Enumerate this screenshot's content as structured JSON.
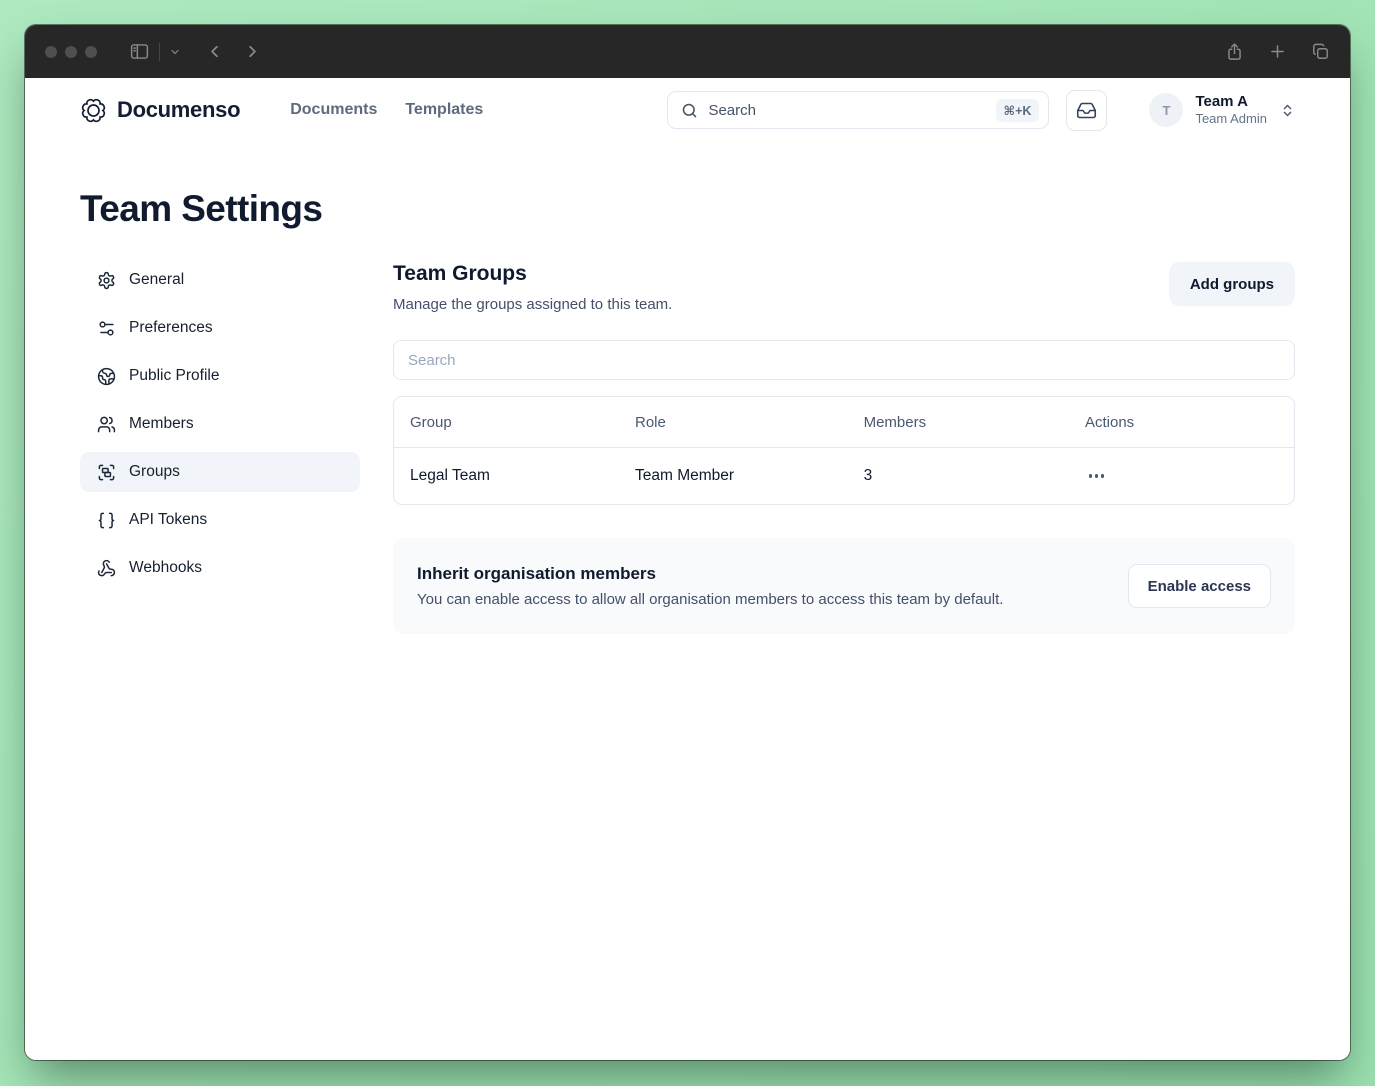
{
  "colors": {
    "desktop_green": "#a2e4b5",
    "titlebar": "#272727",
    "brand_navy": "#131e33",
    "muted_text": "#64748b",
    "active_item_bg": "#f1f5f9",
    "border": "#e2e8f0",
    "card_bg": "#f8fafc"
  },
  "titlebar": {
    "icons": [
      "sidebar-toggle-icon",
      "chevron-down-icon",
      "back-icon",
      "forward-icon",
      "share-icon",
      "new-tab-icon",
      "tab-overview-icon"
    ]
  },
  "header": {
    "brand": "Documenso",
    "logo_icon": "documenso-seal-icon",
    "nav": [
      {
        "label": "Documents"
      },
      {
        "label": "Templates"
      }
    ],
    "search": {
      "placeholder": "Search",
      "shortcut": "⌘+K",
      "icon": "search-icon"
    },
    "inbox_icon": "inbox-icon",
    "team": {
      "avatar_letter": "T",
      "name": "Team A",
      "role": "Team Admin",
      "switch_icon": "chevrons-up-down-icon"
    }
  },
  "page": {
    "title": "Team Settings"
  },
  "sidebar": {
    "items": [
      {
        "label": "General",
        "icon": "gear-icon",
        "active": false
      },
      {
        "label": "Preferences",
        "icon": "sliders-icon",
        "active": false
      },
      {
        "label": "Public Profile",
        "icon": "globe-icon",
        "active": false
      },
      {
        "label": "Members",
        "icon": "users-icon",
        "active": false
      },
      {
        "label": "Groups",
        "icon": "group-icon",
        "active": true
      },
      {
        "label": "API Tokens",
        "icon": "braces-icon",
        "active": false
      },
      {
        "label": "Webhooks",
        "icon": "webhook-icon",
        "active": false
      }
    ]
  },
  "main": {
    "section_title": "Team Groups",
    "section_description": "Manage the groups assigned to this team.",
    "add_button_label": "Add groups",
    "search_placeholder": "Search",
    "table": {
      "headers": [
        "Group",
        "Role",
        "Members",
        "Actions"
      ],
      "rows": [
        {
          "group": "Legal Team",
          "role": "Team Member",
          "members": "3",
          "actions_icon": "more-horizontal-icon"
        }
      ]
    },
    "inherit": {
      "title": "Inherit organisation members",
      "description": "You can enable access to allow all organisation members to access this team by default.",
      "button_label": "Enable access"
    }
  }
}
